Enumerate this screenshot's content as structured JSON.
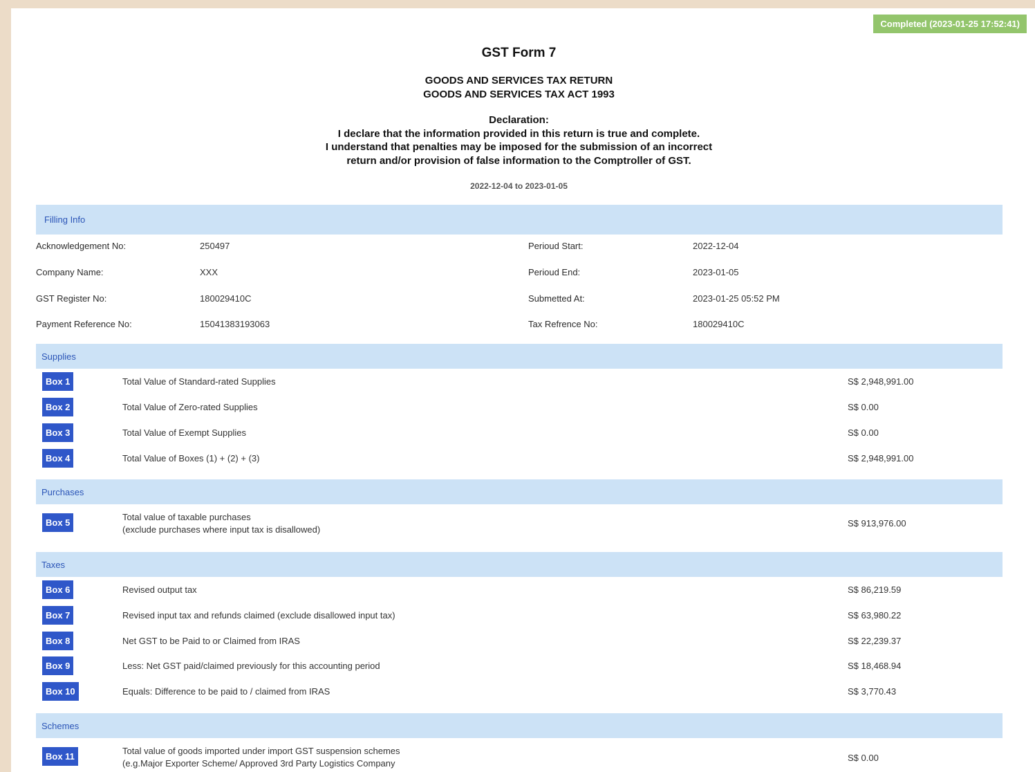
{
  "status": "Completed (2023-01-25 17:52:41)",
  "form_title": "GST Form 7",
  "subtitles": [
    "GOODS AND SERVICES TAX RETURN",
    "GOODS AND SERVICES TAX ACT 1993"
  ],
  "declaration": {
    "heading": "Declaration:",
    "lines": [
      "I declare that the information provided in this return is true and complete.",
      "I understand that penalties may be imposed for the submission of an incorrect",
      "return and/or provision of false information to the Comptroller of GST."
    ]
  },
  "period_range": "2022-12-04 to 2023-01-05",
  "filling_info": {
    "title": "Filling Info",
    "left": [
      {
        "label": "Acknowledgement No:",
        "value": "250497"
      },
      {
        "label": "Company Name:",
        "value": "XXX"
      },
      {
        "label": "GST Register No:",
        "value": "180029410C"
      },
      {
        "label": "Payment Reference No:",
        "value": "15041383193063"
      }
    ],
    "right": [
      {
        "label": "Perioud Start:",
        "value": "2022-12-04"
      },
      {
        "label": "Perioud End:",
        "value": "2023-01-05"
      },
      {
        "label": "Submetted At:",
        "value": "2023-01-25 05:52 PM"
      },
      {
        "label": "Tax Refrence No:",
        "value": "180029410C"
      }
    ]
  },
  "sections": {
    "supplies": {
      "title": "Supplies",
      "boxes": [
        {
          "tag": "Box 1",
          "desc": "Total Value of Standard-rated Supplies",
          "amount": "S$ 2,948,991.00"
        },
        {
          "tag": "Box 2",
          "desc": "Total Value of Zero-rated Supplies",
          "amount": "S$ 0.00"
        },
        {
          "tag": "Box 3",
          "desc": "Total Value of Exempt Supplies",
          "amount": "S$ 0.00"
        },
        {
          "tag": "Box 4",
          "desc": "Total Value of Boxes (1) + (2) + (3)",
          "amount": "S$ 2,948,991.00"
        }
      ]
    },
    "purchases": {
      "title": "Purchases",
      "boxes": [
        {
          "tag": "Box 5",
          "desc": "Total value of taxable purchases",
          "desc2": "(exclude purchases where input tax is disallowed)",
          "amount": "S$ 913,976.00"
        }
      ]
    },
    "taxes": {
      "title": "Taxes",
      "boxes": [
        {
          "tag": "Box 6",
          "desc": "Revised output tax",
          "amount": "S$ 86,219.59"
        },
        {
          "tag": "Box 7",
          "desc": "Revised input tax and refunds claimed (exclude disallowed input tax)",
          "amount": "S$ 63,980.22"
        },
        {
          "tag": "Box 8",
          "desc": "Net GST to be Paid to or Claimed from IRAS",
          "amount": "S$ 22,239.37"
        },
        {
          "tag": "Box 9",
          "desc": "Less: Net GST paid/claimed previously for this accounting period",
          "amount": "S$ 18,468.94"
        },
        {
          "tag": "Box 10",
          "desc": "Equals: Difference to be paid to / claimed from IRAS",
          "amount": "S$ 3,770.43"
        }
      ]
    },
    "schemes": {
      "title": "Schemes",
      "boxes": [
        {
          "tag": "Box 11",
          "desc": "Total value of goods imported under import GST suspension schemes",
          "desc2": "(e.g.Major Exporter Scheme/ Approved 3rd Party Logistics Company",
          "amount": "S$ 0.00"
        }
      ]
    }
  },
  "colors": {
    "status_green": "#93c56c",
    "section_bg": "#cce2f6",
    "section_text": "#2b55b7",
    "box_tag_bg": "#2f57c9",
    "outer_bg": "#ecdcc8"
  }
}
